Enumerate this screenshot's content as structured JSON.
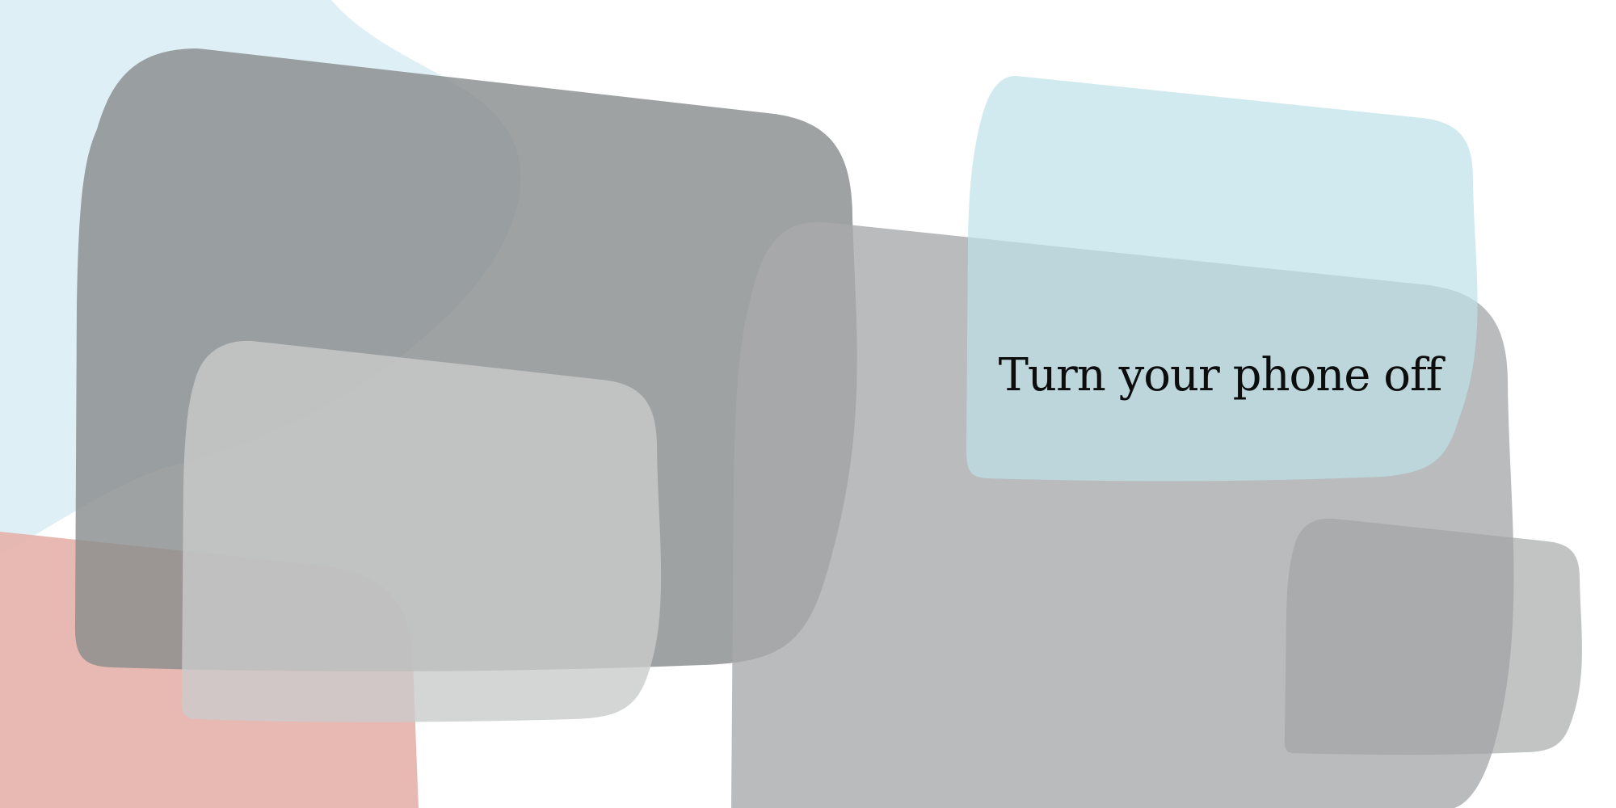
{
  "page": {
    "background": "#ffffff",
    "headline": "Turn your phone off"
  },
  "shapes": [
    {
      "name": "light-blue-blob-shape",
      "color": "#dfeff6"
    },
    {
      "name": "salmon-rounded-shape",
      "color": "#e5b1aa"
    },
    {
      "name": "dark-gray-rounded-shape",
      "color": "#8a8d8d"
    },
    {
      "name": "light-gray-rounded-shape",
      "color": "#c9caca"
    },
    {
      "name": "large-gray-rounded-shape",
      "color": "#a8aaac"
    },
    {
      "name": "pale-blue-rounded-shape",
      "color": "#bde1ea"
    },
    {
      "name": "small-gray-rounded-shape",
      "color": "#a2a3a3"
    }
  ]
}
